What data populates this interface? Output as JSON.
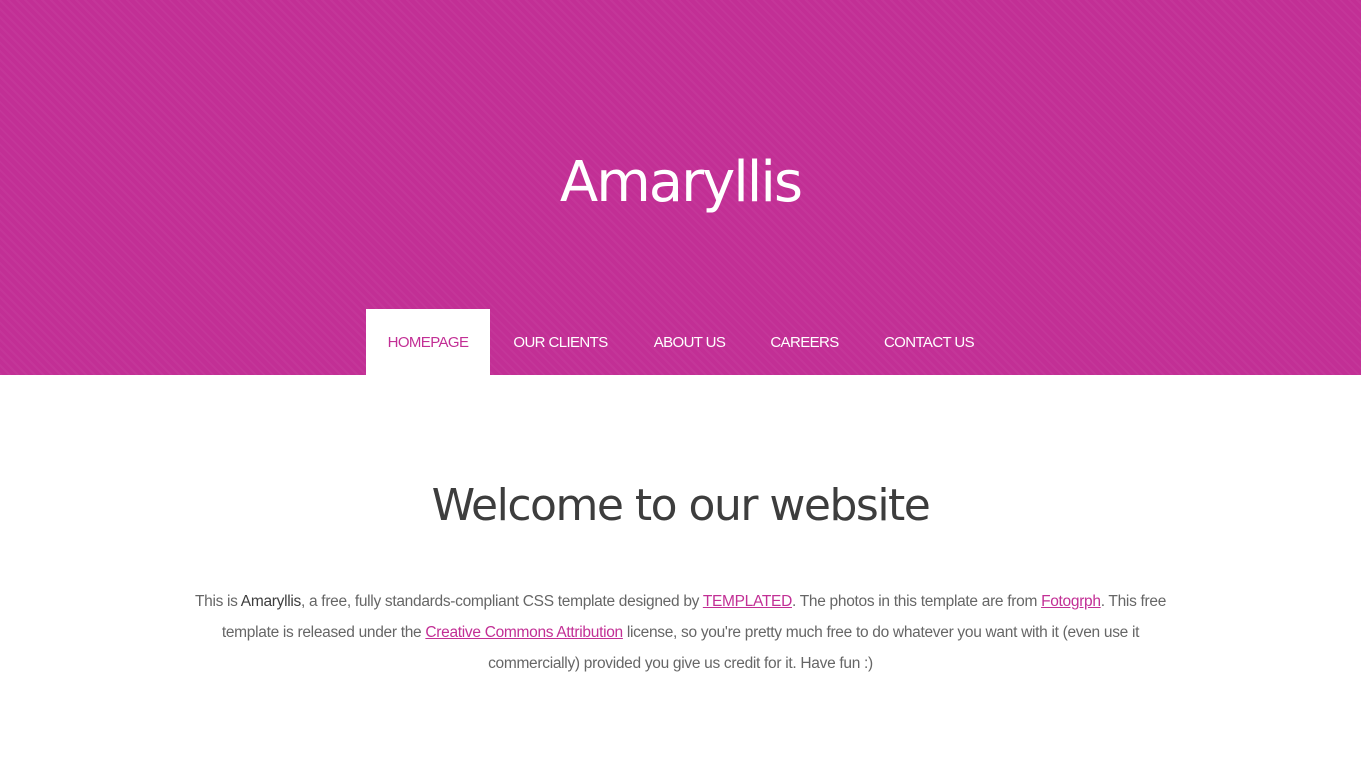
{
  "header": {
    "title": "Amaryllis",
    "background_color": "#c22f95"
  },
  "nav": {
    "items": [
      {
        "label": "HOMEPAGE",
        "active": true
      },
      {
        "label": "OUR CLIENTS",
        "active": false
      },
      {
        "label": "ABOUT US",
        "active": false
      },
      {
        "label": "CAREERS",
        "active": false
      },
      {
        "label": "CONTACT US",
        "active": false
      }
    ]
  },
  "main": {
    "heading": "Welcome to our website",
    "intro": {
      "t1": "This is ",
      "brand": "Amaryllis",
      "t2": ", a free, fully standards-compliant CSS template designed by ",
      "link_templated": "TEMPLATED",
      "t3": ". The photos in this template are from ",
      "link_fotogrph": "Fotogrph",
      "t4": ". This free template is released under the ",
      "link_cc": "Creative Commons Attribution",
      "t5": " license, so you're pretty much free to do whatever you want with it (even use it commercially) provided you give us credit for it. Have fun :)"
    }
  },
  "colors": {
    "accent": "#c22f95",
    "heading_text": "#3d3d3d",
    "body_text": "#666666"
  }
}
